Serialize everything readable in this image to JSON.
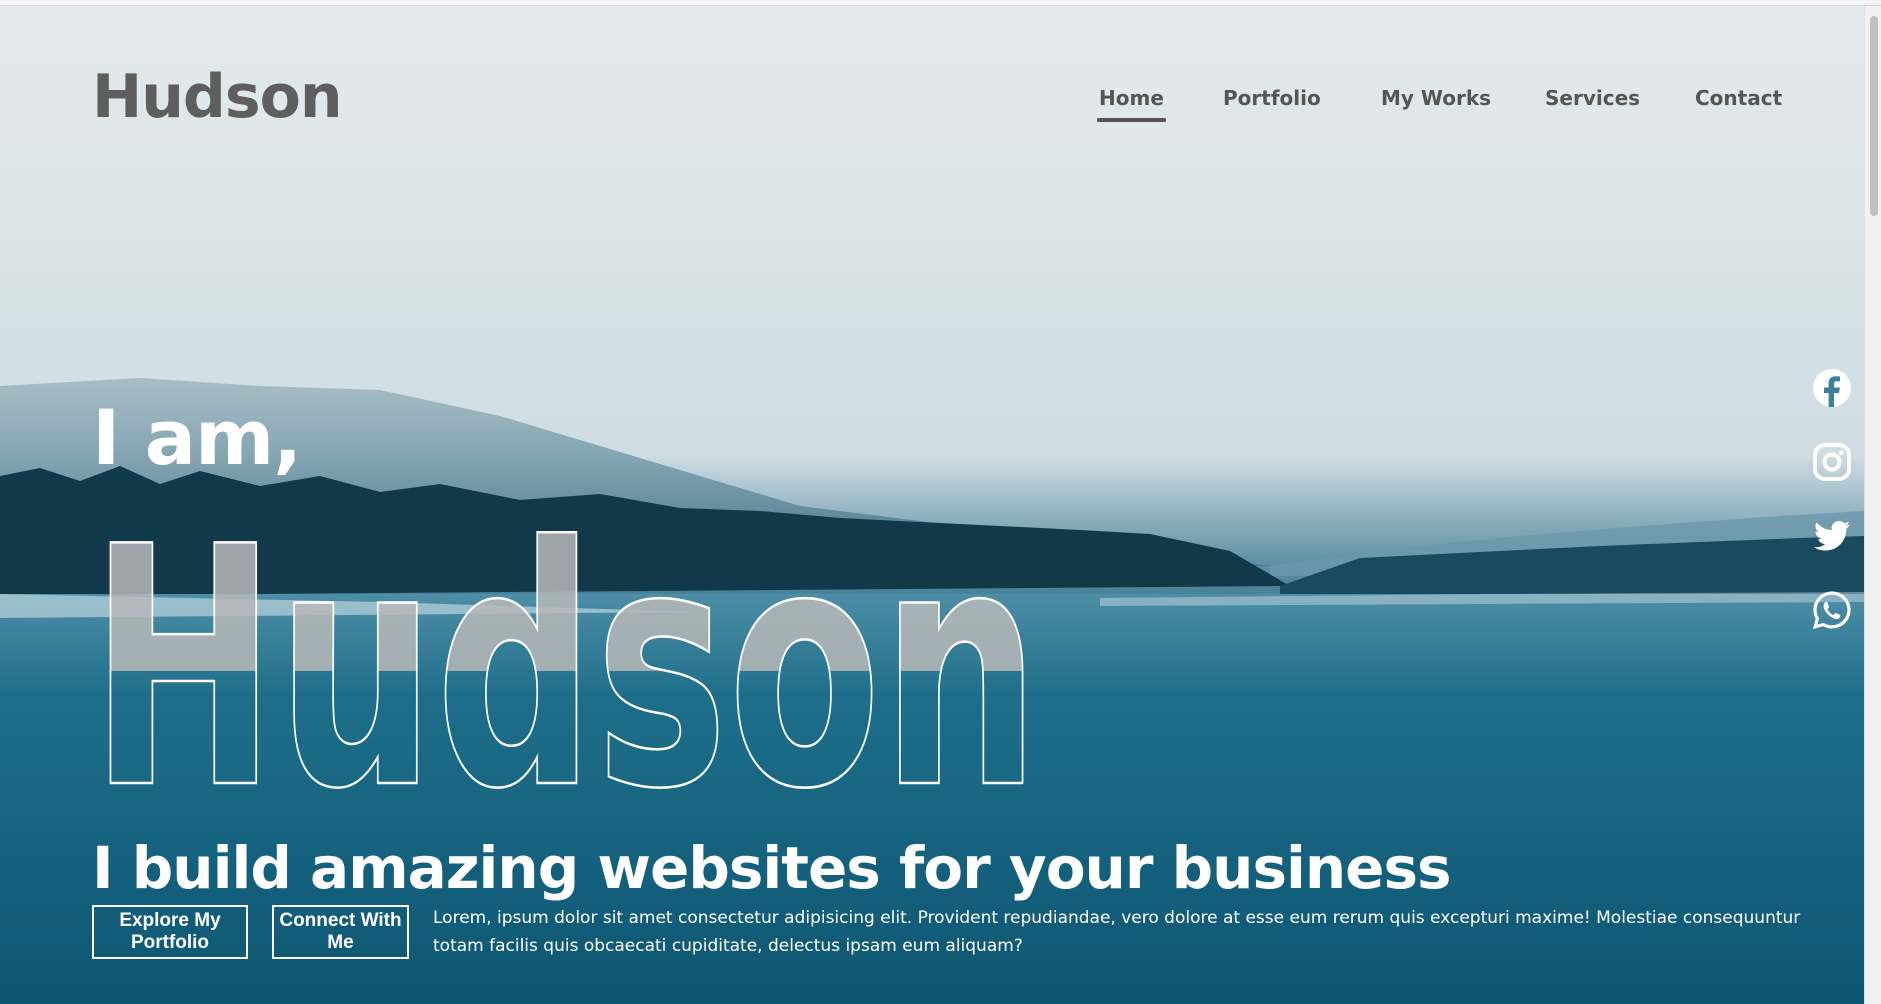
{
  "logo": "Hudson",
  "nav": {
    "items": [
      {
        "label": "Home",
        "active": true
      },
      {
        "label": "Portfolio",
        "active": false
      },
      {
        "label": "My Works",
        "active": false
      },
      {
        "label": "Services",
        "active": false
      },
      {
        "label": "Contact",
        "active": false
      }
    ]
  },
  "hero": {
    "greeting": "I am,",
    "name": "Hudson",
    "tagline": "I build amazing websites for your business",
    "description": "Lorem, ipsum dolor sit amet consectetur adipisicing elit. Provident repudiandae, vero dolore at esse eum rerum quis excepturi maxime! Molestiae consequuntur totam facilis quis obcaecati cupiditate, delectus ipsam eum aliquam?",
    "buttons": {
      "explore": "Explore My Portfolio",
      "connect": "Connect With Me"
    }
  },
  "social": [
    {
      "icon": "facebook-icon"
    },
    {
      "icon": "instagram-icon"
    },
    {
      "icon": "twitter-icon"
    },
    {
      "icon": "whatsapp-icon"
    }
  ],
  "colors": {
    "text_dark": "#555555",
    "text_light": "#ffffff",
    "lake": "#15627e",
    "fog": "#dfe6e9"
  }
}
